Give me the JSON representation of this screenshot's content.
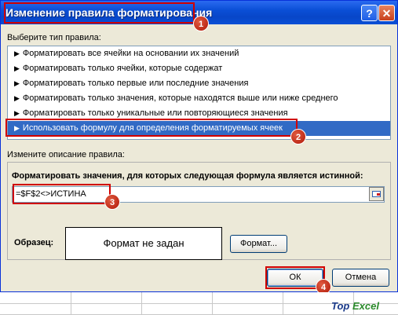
{
  "dialog": {
    "title": "Изменение правила форматирования",
    "help_label": "?",
    "close_label": "✕"
  },
  "rule_type": {
    "label": "Выберите тип правила:",
    "items": [
      "Форматировать все ячейки на основании их значений",
      "Форматировать только ячейки, которые содержат",
      "Форматировать только первые или последние значения",
      "Форматировать только значения, которые находятся выше или ниже среднего",
      "Форматировать только уникальные или повторяющиеся значения",
      "Использовать формулу для определения форматируемых ячеек"
    ],
    "selected_index": 5
  },
  "description": {
    "label": "Измените описание правила:",
    "formula_label": "Форматировать значения, для которых следующая формула является истинной:",
    "formula_value": "=$F$2<>ИСТИНА"
  },
  "preview": {
    "label": "Образец:",
    "text": "Формат не задан",
    "format_button": "Формат..."
  },
  "buttons": {
    "ok": "ОК",
    "cancel": "Отмена"
  },
  "callouts": [
    "1",
    "2",
    "3",
    "4"
  ],
  "logo": {
    "part1": "Top",
    "part2": "Excel"
  },
  "colors": {
    "selection": "#316ac5",
    "callout": "#d00000",
    "titlebar": "#0a4fd6"
  }
}
